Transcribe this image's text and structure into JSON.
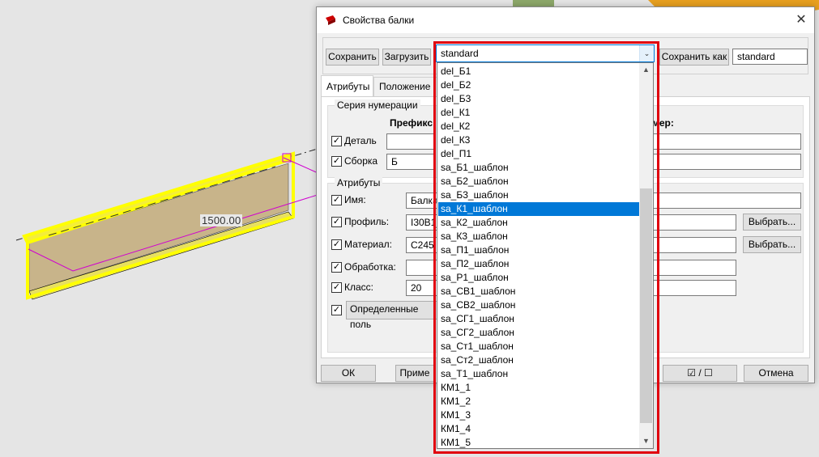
{
  "viewport": {
    "dimension_label": "1500.00"
  },
  "dialog": {
    "title": "Свойства балки",
    "close_glyph": "✕",
    "toolbar": {
      "save_label": "Сохранить",
      "load_label": "Загрузить",
      "save_as_label": "Сохранить как",
      "save_as_value": "standard"
    },
    "tabs": [
      {
        "label": "Атрибуты"
      },
      {
        "label": "Положение"
      }
    ],
    "numbering": {
      "title": "Серия нумерации",
      "prefix_header": "Префикс:",
      "number_header_partial": "мер:",
      "rows": [
        {
          "label": "Деталь",
          "checked": true,
          "prefix": ""
        },
        {
          "label": "Сборка",
          "checked": true,
          "prefix": "Б"
        }
      ]
    },
    "attributes": {
      "title": "Атрибуты",
      "rows": [
        {
          "label": "Имя:",
          "value": "Балка"
        },
        {
          "label": "Профиль:",
          "value": "I30B1_",
          "button": "Выбрать..."
        },
        {
          "label": "Материал:",
          "value": "С245",
          "button": "Выбрать..."
        },
        {
          "label": "Обработка:",
          "value": ""
        },
        {
          "label": "Класс:",
          "value": "20"
        }
      ],
      "user_fields_label": "Определенные поль"
    },
    "bottom": {
      "ok_label": "ОК",
      "apply_label": "Приме",
      "toggle_label": "☑ / ☐",
      "cancel_label": "Отмена"
    }
  },
  "dropdown": {
    "selected_value": "standard",
    "arrow_glyph": "⌄",
    "items": [
      "del_Б1",
      "del_Б2",
      "del_Б3",
      "del_К1",
      "del_К2",
      "del_К3",
      "del_П1",
      "sa_Б1_шаблон",
      "sa_Б2_шаблон",
      "sa_Б3_шаблон",
      "sa_К1_шаблон",
      "sa_К2_шаблон",
      "sa_К3_шаблон",
      "sa_П1_шаблон",
      "sa_П2_шаблон",
      "sa_Р1_шаблон",
      "sa_СВ1_шаблон",
      "sa_СВ2_шаблон",
      "sa_СГ1_шаблон",
      "sa_СГ2_шаблон",
      "sa_Ст1_шаблон",
      "sa_Ст2_шаблон",
      "sa_Т1_шаблон",
      "КМ1_1",
      "КМ1_2",
      "КМ1_3",
      "КМ1_4",
      "КМ1_5"
    ],
    "selected_index": 10
  }
}
